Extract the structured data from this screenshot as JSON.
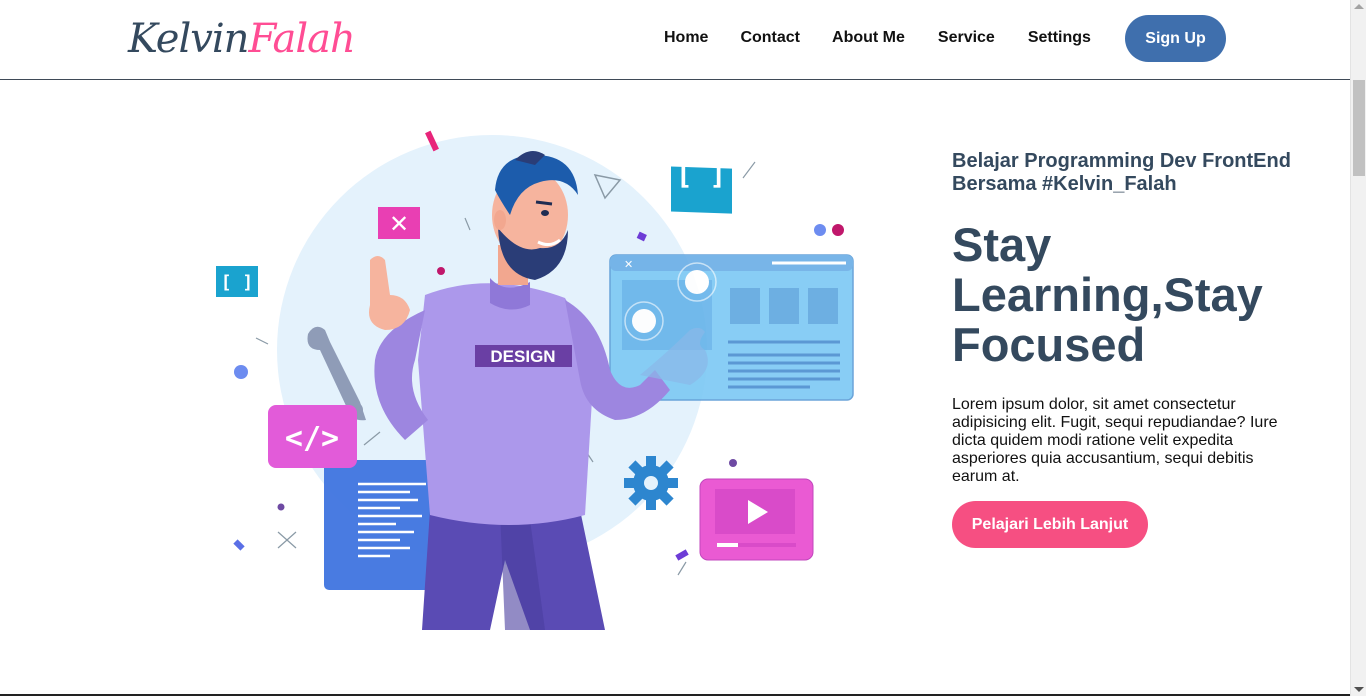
{
  "header": {
    "logo_first": "Kelvin",
    "logo_second": "Falah",
    "nav": [
      "Home",
      "Contact",
      "About Me",
      "Service",
      "Settings"
    ],
    "signup_label": "Sign Up"
  },
  "hero": {
    "subtitle": "Belajar Programming Dev FrontEnd Bersama #Kelvin_Falah",
    "headline_line1": "Stay",
    "headline_line2": "Learning,Stay",
    "headline_line3": "Focused",
    "paragraph": "Lorem ipsum dolor, sit amet consectetur adipisicing elit. Fugit, sequi repudiandae? Iure dicta quidem modi ratione velit expedita asperiores quia accusantium, sequi debitis earum at.",
    "cta_label": "Pelajari Lebih Lanjut",
    "illustration_shirt_text": "DESIGN"
  },
  "colors": {
    "accent": "#3f6fad",
    "brand_pink": "#ff4d94",
    "heading": "#34495e",
    "cta": "#f64f82"
  },
  "icons": [
    "close-icon",
    "code-icon",
    "play-icon",
    "gear-icon",
    "wrench-icon",
    "bracket-icon"
  ]
}
